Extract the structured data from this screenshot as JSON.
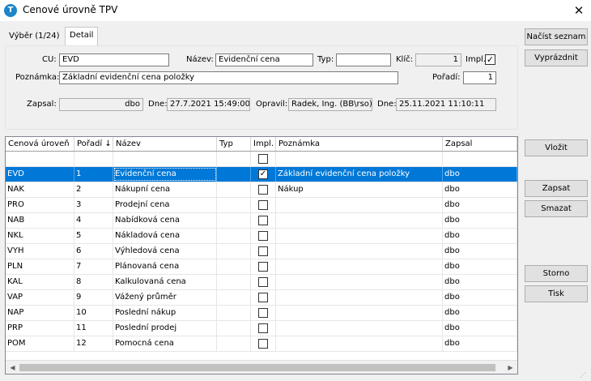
{
  "window": {
    "title": "Cenové úrovně TPV",
    "app_icon": "T",
    "close": "✕"
  },
  "tabs": [
    {
      "label": "Výběr (1/24)"
    },
    {
      "label": "Detail"
    }
  ],
  "detail": {
    "cu_label": "CU:",
    "cu_value": "EVD",
    "nazev_label": "Název:",
    "nazev_value": "Evidenční cena",
    "typ_label": "Typ:",
    "typ_value": "",
    "klic_label": "Klíč:",
    "klic_value": "1",
    "impl_label": "Impl.",
    "impl_checked": "✓",
    "poznamka_label": "Poznámka:",
    "poznamka_value": "Základní evidenční cena položky",
    "poradi_label": "Pořadí:",
    "poradi_value": "1",
    "zapsal_label": "Zapsal:",
    "zapsal_value": "dbo",
    "dne1_label": "Dne:",
    "dne1_value": "27.7.2021 15:49:00",
    "opravil_label": "Opravil:",
    "opravil_value": "Radek, Ing. (BB\\rso)",
    "dne2_label": "Dne:",
    "dne2_value": "25.11.2021 11:10:11"
  },
  "buttons": {
    "nacist": "Načíst seznam",
    "vyprazdnit": "Vyprázdnit",
    "vlozit": "Vložit",
    "zapsat": "Zapsat",
    "smazat": "Smazat",
    "storno": "Storno",
    "tisk": "Tisk"
  },
  "grid": {
    "columns": [
      "Cenová úroveň",
      "Pořadí ↓",
      "Název",
      "Typ",
      "Impl.",
      "Poznámka",
      "Zapsal"
    ],
    "rows": [
      {
        "cu": "EVD",
        "poradi": "1",
        "nazev": "Evidenční cena",
        "typ": "",
        "impl": "✓",
        "poznamka": "Základní evidenční cena položky",
        "zapsal": "dbo"
      },
      {
        "cu": "NAK",
        "poradi": "2",
        "nazev": "Nákupní cena",
        "typ": "",
        "impl": "",
        "poznamka": "Nákup",
        "zapsal": "dbo"
      },
      {
        "cu": "PRO",
        "poradi": "3",
        "nazev": "Prodejní cena",
        "typ": "",
        "impl": "",
        "poznamka": "",
        "zapsal": "dbo"
      },
      {
        "cu": "NAB",
        "poradi": "4",
        "nazev": "Nabídková cena",
        "typ": "",
        "impl": "",
        "poznamka": "",
        "zapsal": "dbo"
      },
      {
        "cu": "NKL",
        "poradi": "5",
        "nazev": "Nákladová cena",
        "typ": "",
        "impl": "",
        "poznamka": "",
        "zapsal": "dbo"
      },
      {
        "cu": "VYH",
        "poradi": "6",
        "nazev": "Výhledová cena",
        "typ": "",
        "impl": "",
        "poznamka": "",
        "zapsal": "dbo"
      },
      {
        "cu": "PLN",
        "poradi": "7",
        "nazev": "Plánovaná cena",
        "typ": "",
        "impl": "",
        "poznamka": "",
        "zapsal": "dbo"
      },
      {
        "cu": "KAL",
        "poradi": "8",
        "nazev": "Kalkulovaná cena",
        "typ": "",
        "impl": "",
        "poznamka": "",
        "zapsal": "dbo"
      },
      {
        "cu": "VAP",
        "poradi": "9",
        "nazev": "Vážený průměr",
        "typ": "",
        "impl": "",
        "poznamka": "",
        "zapsal": "dbo"
      },
      {
        "cu": "NAP",
        "poradi": "10",
        "nazev": "Poslední nákup",
        "typ": "",
        "impl": "",
        "poznamka": "",
        "zapsal": "dbo"
      },
      {
        "cu": "PRP",
        "poradi": "11",
        "nazev": "Poslední prodej",
        "typ": "",
        "impl": "",
        "poznamka": "",
        "zapsal": "dbo"
      },
      {
        "cu": "POM",
        "poradi": "12",
        "nazev": "Pomocná cena",
        "typ": "",
        "impl": "",
        "poznamka": "",
        "zapsal": "dbo"
      }
    ],
    "selected_row": 0
  },
  "colors": {
    "selection": "#0078d7",
    "accent_icon": "#1c86c9"
  }
}
